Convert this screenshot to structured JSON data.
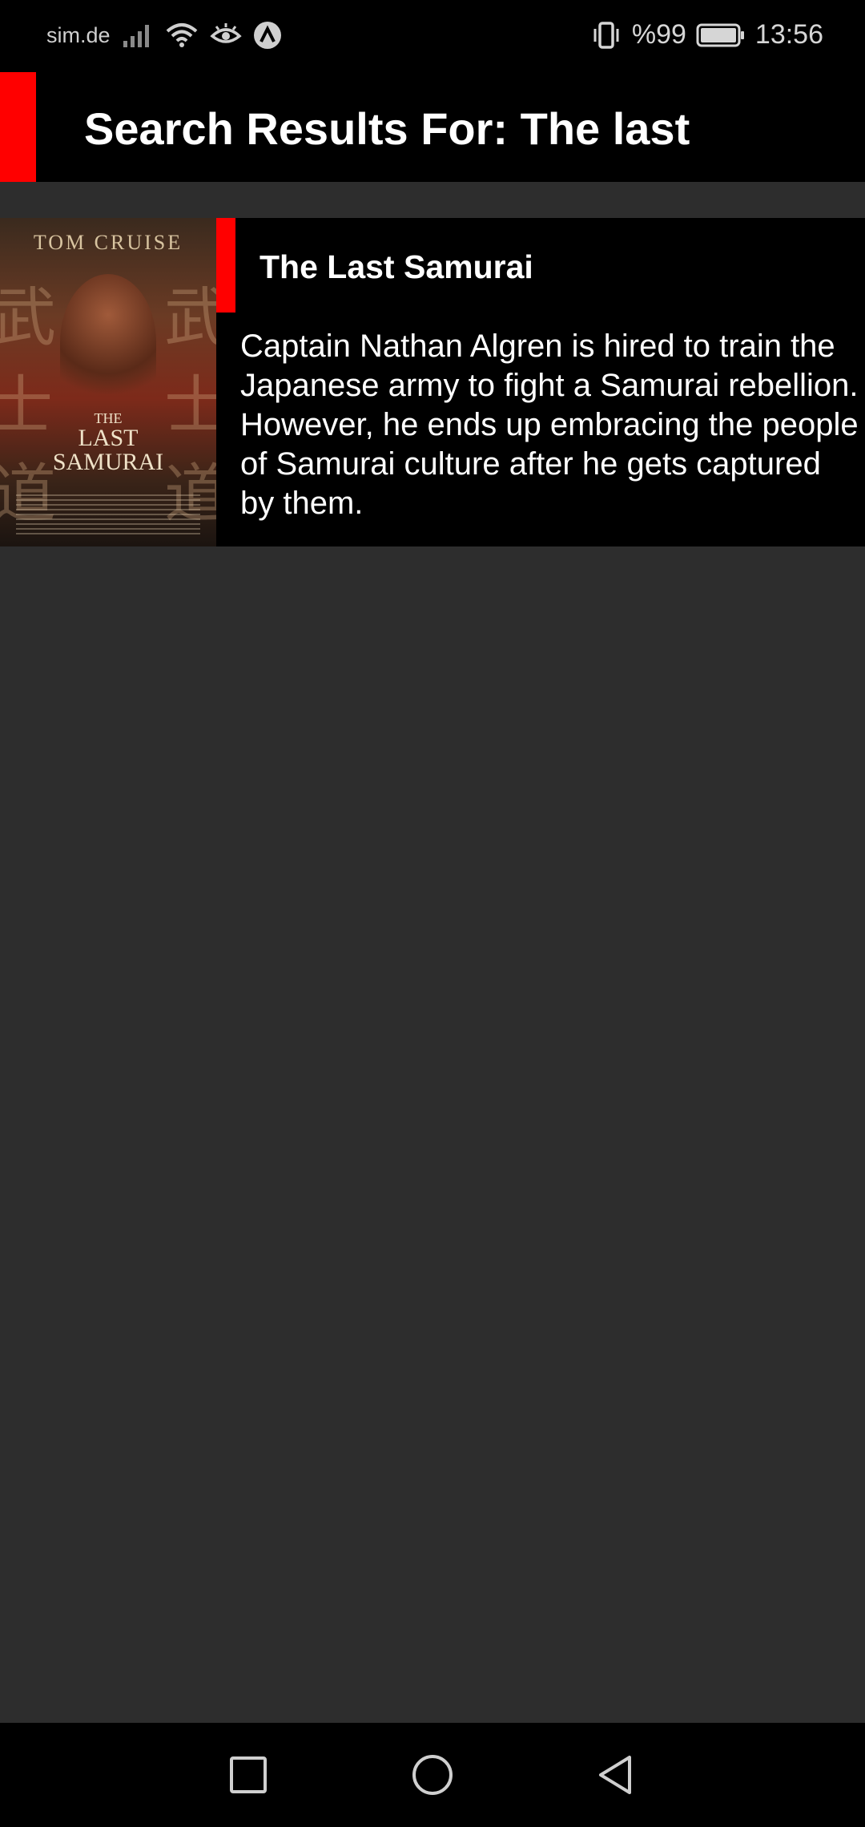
{
  "status_bar": {
    "carrier": "sim.de",
    "battery_percent": "%99",
    "time": "13:56",
    "icons": [
      "signal-icon",
      "wifi-icon",
      "eye-icon",
      "app-badge-icon",
      "vibrate-icon",
      "battery-icon"
    ]
  },
  "header": {
    "title": "Search Results For: The last",
    "accent_color": "#ff0000"
  },
  "results": [
    {
      "title": "The Last Samurai",
      "description": "Captain Nathan Algren is hired to train the Japanese army to fight a Samurai rebellion. However, he ends up embracing the people of Samurai culture after he gets captured by them.",
      "poster": {
        "top_text": "TOM CRUISE",
        "title_small": "THE",
        "title_line1": "LAST",
        "title_line2": "SAMURAI"
      }
    }
  ],
  "nav_bar": {
    "buttons": [
      "recents-icon",
      "home-icon",
      "back-icon"
    ]
  }
}
